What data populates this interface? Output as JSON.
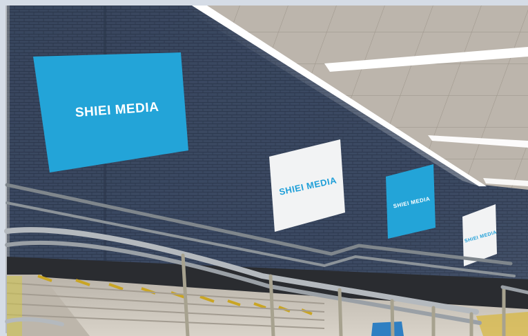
{
  "scene": {
    "posters": [
      {
        "text": "SHIEI MEDIA",
        "style": "blue-bg-white-text",
        "background": "#23a4d8",
        "text_color": "#ffffff"
      },
      {
        "text": "SHIEI MEDIA",
        "style": "white-bg-blue-text",
        "background": "#f2f3f4",
        "text_color": "#1f9fd8"
      },
      {
        "text": "SHIEI MEDIA",
        "style": "blue-bg-white-text",
        "background": "#23a4d8",
        "text_color": "#ffffff"
      },
      {
        "text": "SHIEI MEDIA",
        "style": "white-bg-blue-text",
        "background": "#f2f3f4",
        "text_color": "#1f9fd8"
      }
    ],
    "colors": {
      "wall_tile": "#3c4a63",
      "ceiling": "#c9c3bb",
      "light_strip": "#ffffff",
      "stairs": "#c8c2b8",
      "stair_edge": "#c9a524",
      "handrail": "#9aa0a6"
    }
  }
}
